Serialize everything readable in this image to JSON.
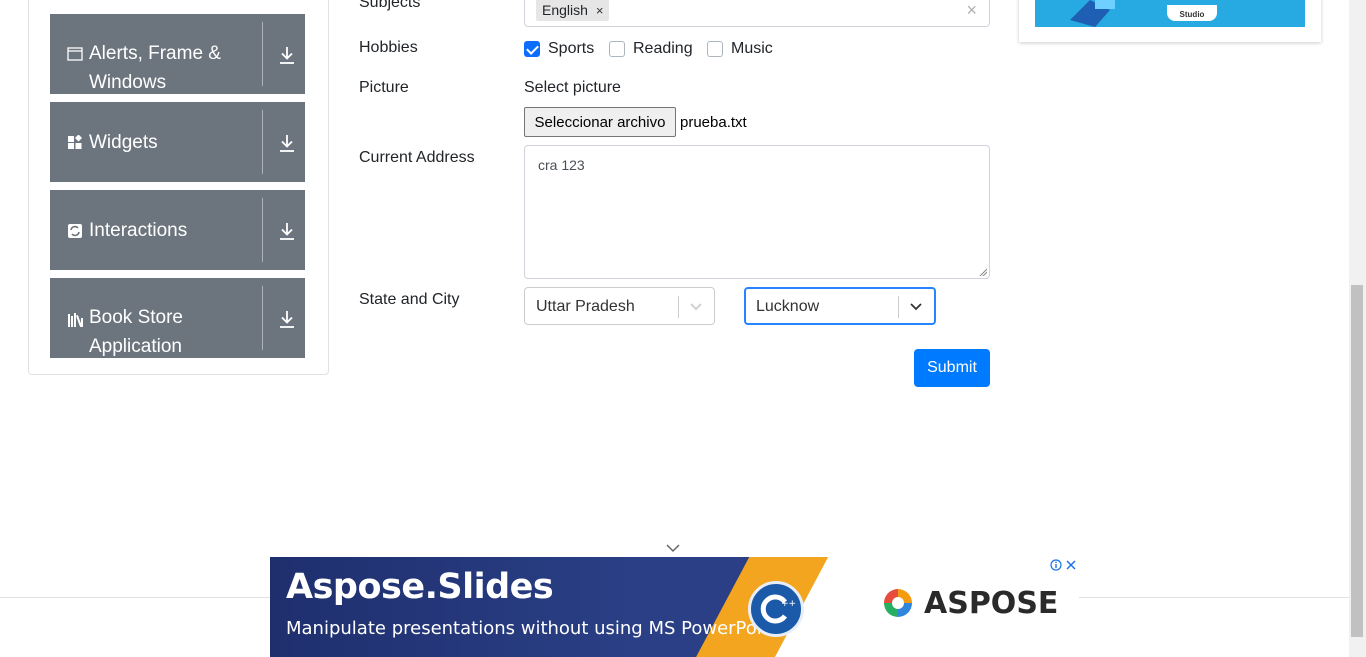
{
  "sidebar": {
    "groups": [
      {
        "label": "Alerts, Frame & Windows",
        "icon": "window-icon"
      },
      {
        "label": "Widgets",
        "icon": "widgets-icon"
      },
      {
        "label": "Interactions",
        "icon": "interactions-icon"
      },
      {
        "label": "Book Store Application",
        "icon": "book-store-icon"
      }
    ]
  },
  "form": {
    "subjects": {
      "label": "Subjects",
      "chip": "English",
      "chip_remove": "×",
      "clear": "×"
    },
    "hobbies": {
      "label": "Hobbies",
      "options": [
        {
          "label": "Sports",
          "checked": true
        },
        {
          "label": "Reading",
          "checked": false
        },
        {
          "label": "Music",
          "checked": false
        }
      ]
    },
    "picture": {
      "label": "Picture",
      "select_text": "Select picture",
      "button": "Seleccionar archivo",
      "file_name": "prueba.txt"
    },
    "address": {
      "label": "Current Address",
      "value": "cra 123"
    },
    "state_city": {
      "label": "State and City",
      "state": "Uttar Pradesh",
      "city": "Lucknow"
    },
    "submit": "Submit"
  },
  "right_ad": {
    "text": "Studio"
  },
  "banner": {
    "title": "Aspose.Slides",
    "subtitle": "Manipulate presentations without using MS PowerPoint",
    "brand": "ASPOSE",
    "colors": {
      "navy": "#1f2f6e",
      "orange": "#f3a51f"
    }
  },
  "colors": {
    "sidebar_group": "#6c757d",
    "primary": "#007bff",
    "focus": "#2684ff"
  }
}
